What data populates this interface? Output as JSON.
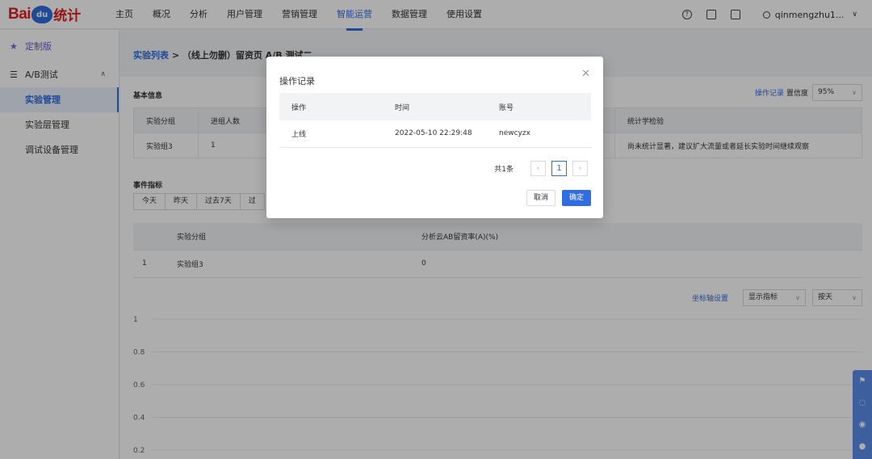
{
  "brand": {
    "bai": "Bai",
    "du": "du",
    "tongji": "统计",
    "color": "#e1201d"
  },
  "nav": [
    {
      "label": "主页"
    },
    {
      "label": "概况"
    },
    {
      "label": "分析"
    },
    {
      "label": "用户管理"
    },
    {
      "label": "营销管理"
    },
    {
      "label": "智能运营",
      "active": true
    },
    {
      "label": "数据管理"
    },
    {
      "label": "使用设置"
    }
  ],
  "header_right": {
    "user": "qinmengzhu1...",
    "icons": [
      "help-icon",
      "mail-icon",
      "message-icon",
      "user-icon"
    ]
  },
  "sidebar": {
    "fav": "定制版",
    "group": "A/B测试",
    "items": [
      {
        "label": "实验管理",
        "active": true
      },
      {
        "label": "实验层管理"
      },
      {
        "label": "调试设备管理"
      }
    ]
  },
  "breadcrumb": {
    "link": "实验列表",
    "sep": " > ",
    "current": "（线上勿删）留资页 A/B 测试二"
  },
  "basic": {
    "title": "基本信息",
    "op_record": "操作记录",
    "confidence_label": "置信度",
    "confidence_value": "95%",
    "columns": [
      "实验分组",
      "进组人数",
      "",
      "",
      "",
      "统计学检验"
    ],
    "rows": [
      [
        "实验组3",
        "1",
        "",
        "",
        "",
        "尚未统计显著，建议扩大流量或者延长实验时间继续观察"
      ]
    ]
  },
  "events": {
    "title": "事件指标",
    "tabs": [
      "今天",
      "昨天",
      "过去7天",
      "过"
    ],
    "columns": [
      "",
      "实验分组",
      "分析云AB留资率(A)(%)"
    ],
    "rows": [
      [
        "1",
        "实验组3",
        "0"
      ]
    ]
  },
  "chart_controls": {
    "axis_setting": "坐标轴设置",
    "metric_select": "显示指标",
    "granularity_select": "按天"
  },
  "chart_data": {
    "type": "line",
    "ylim": [
      0,
      1
    ],
    "y_ticks": [
      "1",
      "0.8",
      "0.6",
      "0.4",
      "0.2"
    ],
    "series": []
  },
  "modal": {
    "title": "操作记录",
    "columns": [
      "操作",
      "时间",
      "账号"
    ],
    "rows": [
      [
        "上线",
        "2022-05-10 22:29:48",
        "newcyzx"
      ]
    ],
    "total": "共1条",
    "page": "1",
    "cancel": "取消",
    "ok": "确定"
  },
  "colors": {
    "primary": "#2f6de1",
    "mask": "rgba(0,0,0,0.32)"
  }
}
